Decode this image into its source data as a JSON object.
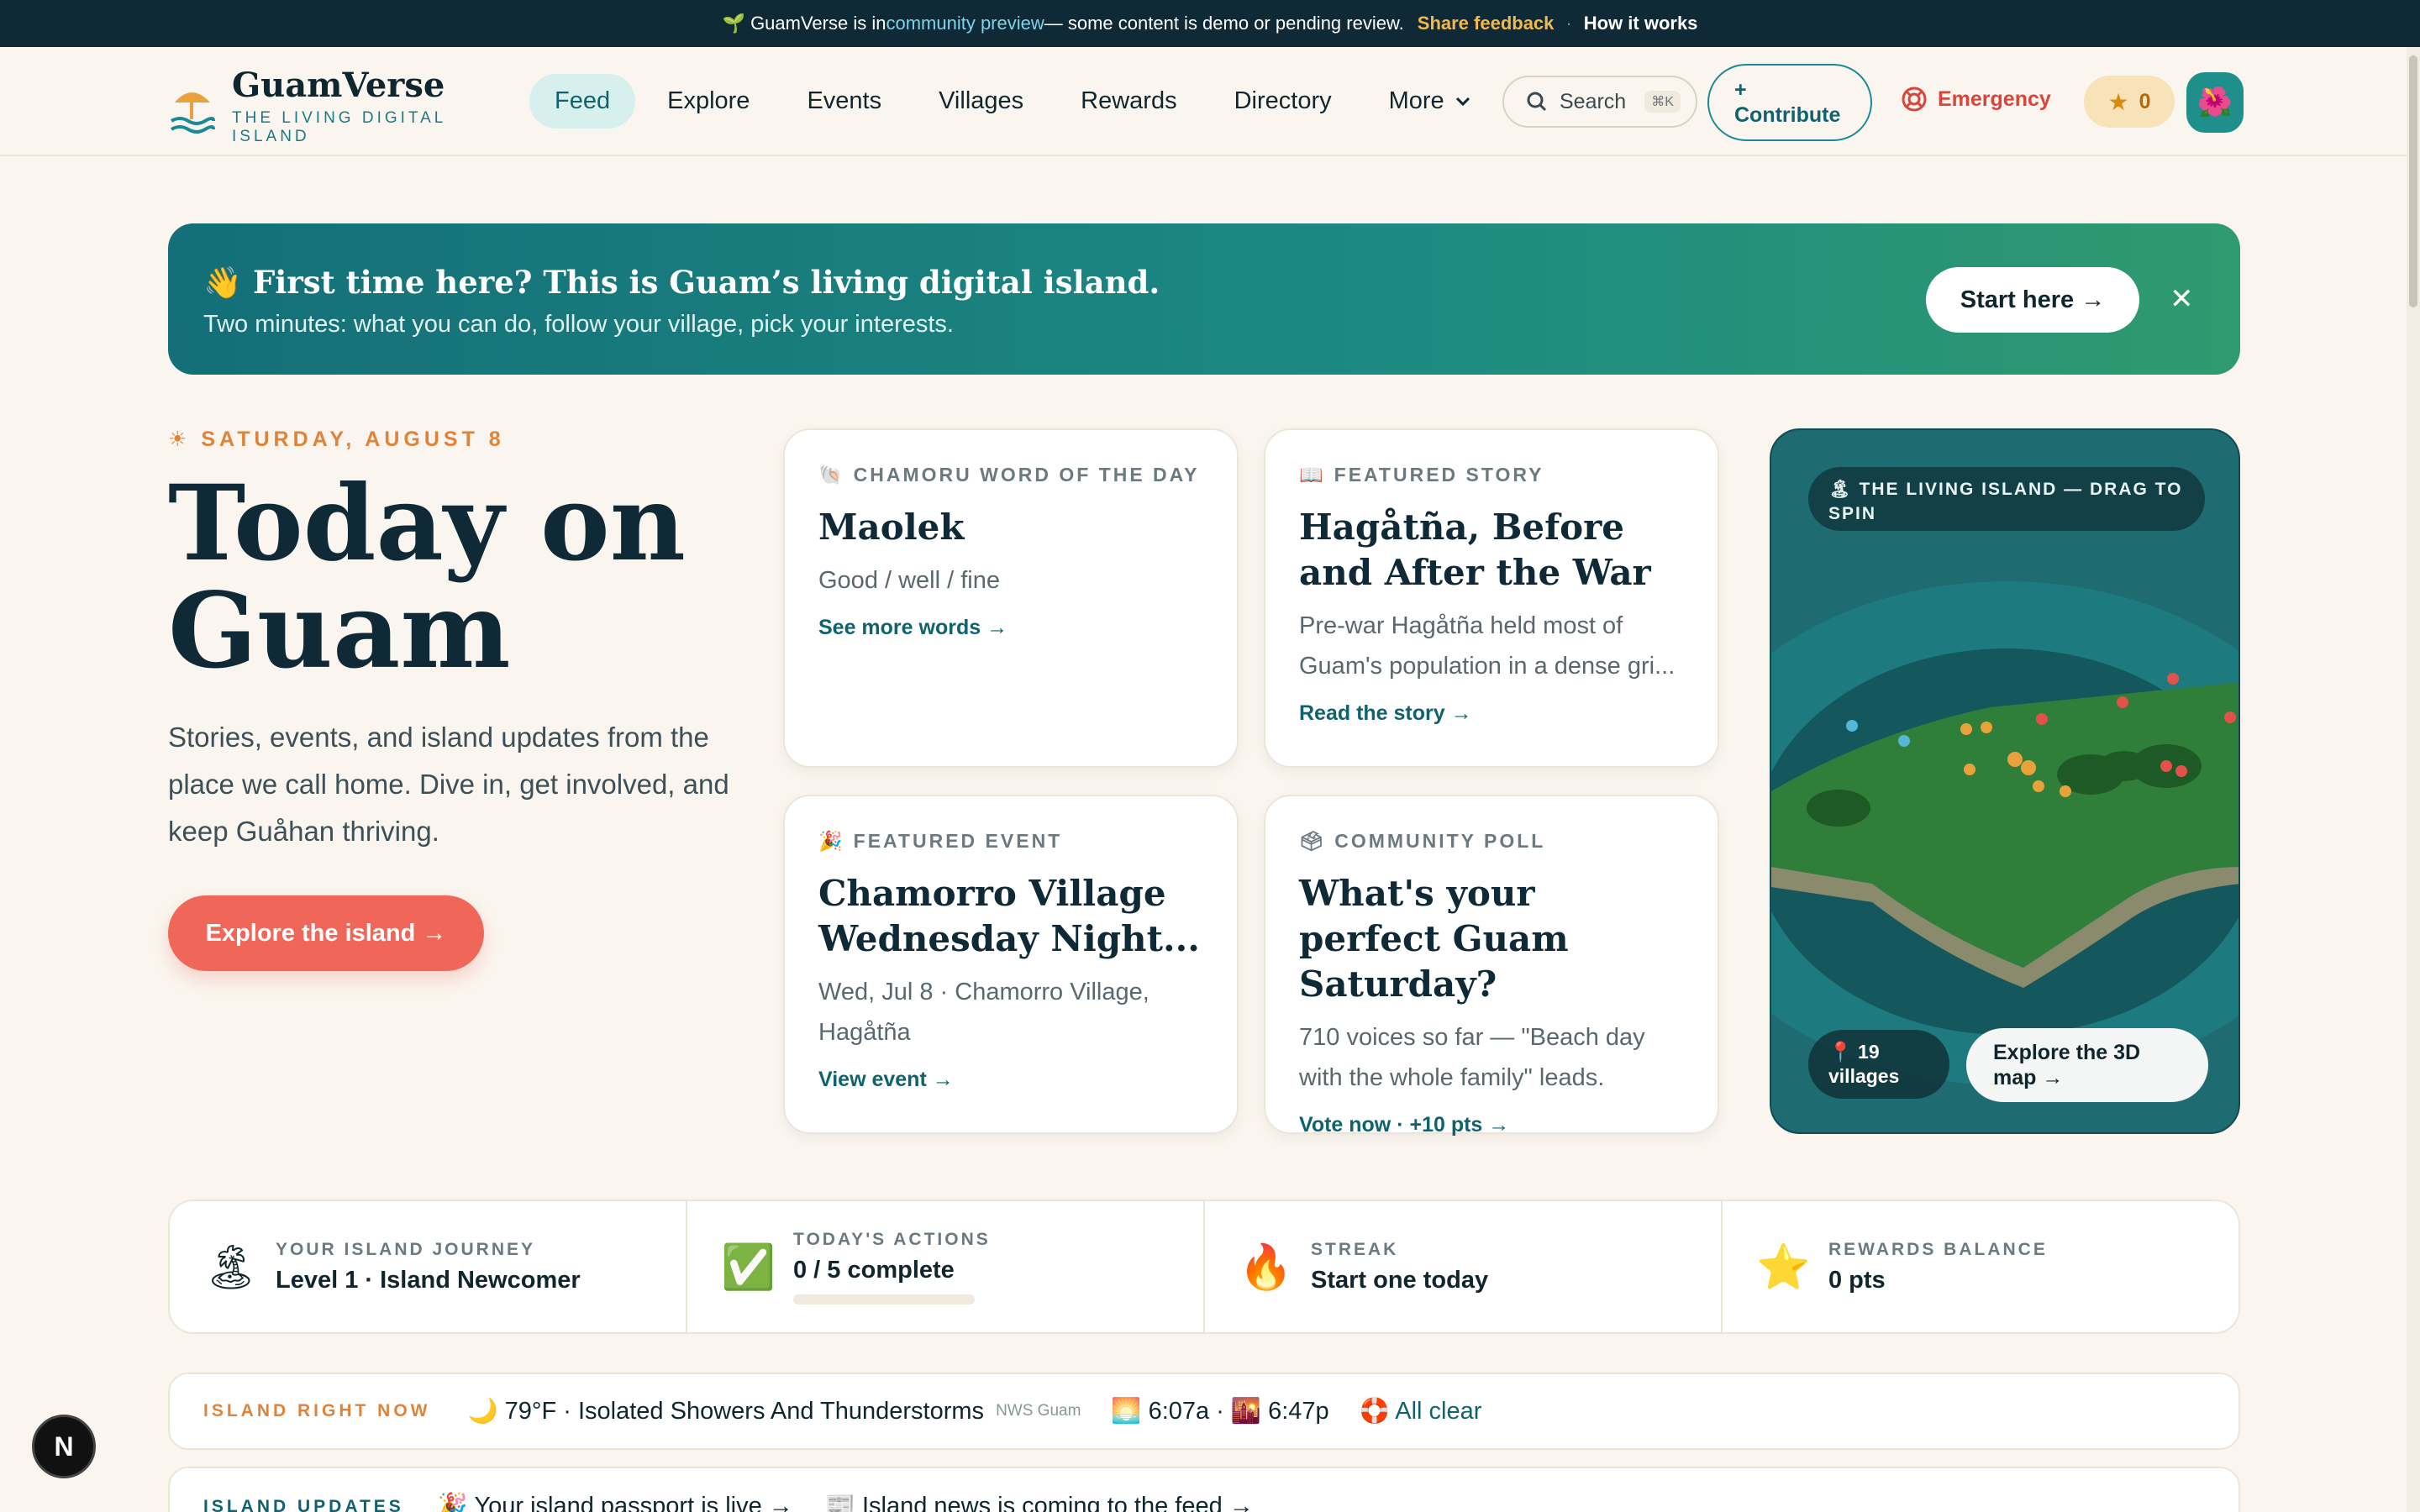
{
  "topbar": {
    "prefix": "🌱 GuamVerse is in ",
    "preview": "community preview",
    "middle": " — some content is demo or pending review.",
    "feedback": "Share feedback",
    "sep": "·",
    "how": "How it works"
  },
  "brand": {
    "name": "GuamVerse",
    "tagline": "THE LIVING DIGITAL ISLAND"
  },
  "nav": {
    "links": [
      "Feed",
      "Explore",
      "Events",
      "Villages",
      "Rewards",
      "Directory",
      "More"
    ],
    "active": "Feed",
    "search_label": "Search",
    "search_kbd": "⌘K",
    "contribute_plus": "+",
    "contribute_label": "Contribute",
    "emergency_label": "Emergency",
    "points_value": "0",
    "avatar_glyph": "🌺"
  },
  "welcome": {
    "title": "👋 First time here? This is Guam’s living digital island.",
    "subtitle": "Two minutes: what you can do, follow your village, pick your interests.",
    "cta": "Start here →",
    "close": "✕"
  },
  "hero": {
    "date": "☀ SATURDAY, AUGUST 8",
    "title": "Today on Guam",
    "subtitle": "Stories, events, and island updates from the place we call home. Dive in, get involved, and keep Guåhan thriving.",
    "cta": "Explore the island →"
  },
  "cards": {
    "word": {
      "kicker": "CHAMORU WORD OF THE DAY",
      "icon": "🐚",
      "title": "Maolek",
      "body": "Good / well / fine",
      "link": "See more words →"
    },
    "story": {
      "kicker": "FEATURED STORY",
      "icon": "📖",
      "title": "Hagåtña, Before and After the War",
      "body": "Pre-war Hagåtña held most of Guam's population in a dense gri...",
      "link": "Read the story →"
    },
    "event": {
      "kicker": "FEATURED EVENT",
      "icon": "🎉",
      "title": "Chamorro Village Wednesday Night...",
      "body": "Wed, Jul 8 · Chamorro Village, Hagåtña",
      "link": "View event →"
    },
    "poll": {
      "kicker": "COMMUNITY POLL",
      "icon": "🗳",
      "title": "What's your perfect Guam Saturday?",
      "body": "710 voices so far — \"Beach day with the whole family\" leads.",
      "link": "Vote now · +10 pts →"
    }
  },
  "map": {
    "pill": "🏝 THE LIVING ISLAND — DRAG TO SPIN",
    "villages": "📍 19 villages",
    "explore": "Explore the 3D map →"
  },
  "journey": [
    {
      "icon": "🏝",
      "label": "YOUR ISLAND JOURNEY",
      "value": "Level 1 · Island Newcomer"
    },
    {
      "icon": "✅",
      "label": "TODAY'S ACTIONS",
      "value": "0 / 5 complete",
      "progress": 0
    },
    {
      "icon": "🔥",
      "label": "STREAK",
      "value": "Start one today"
    },
    {
      "icon": "⭐",
      "label": "REWARDS BALANCE",
      "value": "0 pts"
    }
  ],
  "island_now": {
    "label": "ISLAND RIGHT NOW",
    "weather": "🌙 79°F · Isolated Showers And Thunderstorms",
    "source": "NWS Guam",
    "sun": "🌅 6:07a · 🌇 6:47p",
    "status": "🛟 All clear"
  },
  "updates": {
    "label": "ISLAND UPDATES",
    "items": [
      "🎉 Your island passport is live →",
      "📰 Island news is coming to the feed →"
    ]
  },
  "dev_badge": "N",
  "colors": {
    "teal": "#10626e",
    "coral": "#f0675a",
    "amber": "#e0833a",
    "navy": "#0f2a36"
  }
}
